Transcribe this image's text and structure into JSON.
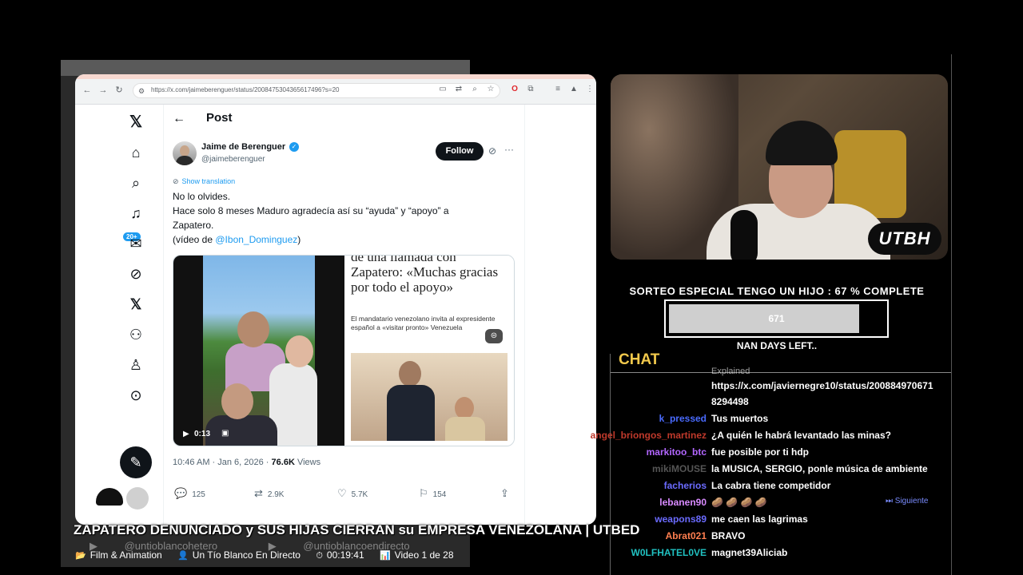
{
  "browser": {
    "url": "https://x.com/jaimeberenguer/status/2008475304365617496?s=20"
  },
  "x_sidebar": {
    "notif_badge": "20+"
  },
  "post": {
    "header_title": "Post",
    "author_name": "Jaime de Berenguer",
    "author_handle": "@jaimeberenguer",
    "follow_label": "Follow",
    "show_translation": "Show translation",
    "text_lines": [
      "No lo olvides.",
      "Hace solo 8 meses Maduro agradecía así su “ayuda” y “apoyo” a",
      "Zapatero."
    ],
    "text_paren_prefix": "(vídeo de ",
    "text_mention": "@Ibon_Dominguez",
    "text_paren_suffix": ")",
    "video_time": "0:13",
    "article_headline": "de una llamada con Zapatero: «Muchas gracias por todo el apoyo»",
    "article_sub": "El mandatario venezolano invita al expresidente español a «visitar pronto» Venezuela",
    "timestamp": "10:46 AM · Jan 6, 2026 · ",
    "views_count": "76.6K",
    "views_label": " Views",
    "replies": "125",
    "reposts": "2.9K",
    "likes": "5.7K",
    "bookmarks": "154"
  },
  "webcam": {
    "badge": "UTBH"
  },
  "giveaway": {
    "title": "SORTEO ESPECIAL TENGO UN HIJO :  67 % COMPLETE",
    "progress_value": "671",
    "progress_fraction": 0.87,
    "days_left": "NAN DAYS LEFT.."
  },
  "chat": {
    "title": "CHAT",
    "cut_line": "Explained",
    "link_line1": "https://x.com/javiernegre10/status/200884970671",
    "link_line2": "8294498",
    "messages": [
      {
        "user": "k_pressed",
        "text": "Tus muertos",
        "color": "#4a6bff"
      },
      {
        "user": "angel_briongos_martinez",
        "text": "¿A quién le habrá levantado las minas?",
        "color": "#c0392b"
      },
      {
        "user": "markitoo_btc",
        "text": "fue posible por ti hdp",
        "color": "#b266ff"
      },
      {
        "user": "mikiMOUSE",
        "text": "la MUSICA, SERGIO, ponle música de ambiente",
        "color": "#555555"
      },
      {
        "user": "facherios",
        "text": "La cabra tiene competidor",
        "color": "#6b6bff"
      },
      {
        "user": "lebanen90",
        "text": "🥔 🥔 🥔 🥔",
        "color": "#d98bff"
      },
      {
        "user": "weapons89",
        "text": "me caen las lagrimas",
        "color": "#6b6bff"
      },
      {
        "user": "Abrat021",
        "text": "BRAVO",
        "color": "#ff7f50"
      },
      {
        "user": "W0LFHATEL0VE",
        "text": "magnet39Aliciab",
        "color": "#20c0c0"
      }
    ],
    "next_label": "⏭ Siguiente"
  },
  "caption": {
    "title": "ZAPATERO DENUNCIADO y SUS HIJAS CIERRAN su EMPRESA VENEZOLANA | UTBED",
    "handle1": "@untioblancohetero",
    "handle2": "@untioblancoendirecto",
    "category": "Film & Animation",
    "channel": "Un Tío Blanco En Directo",
    "duration": "00:19:41",
    "playlist": "Video 1 de 28"
  }
}
